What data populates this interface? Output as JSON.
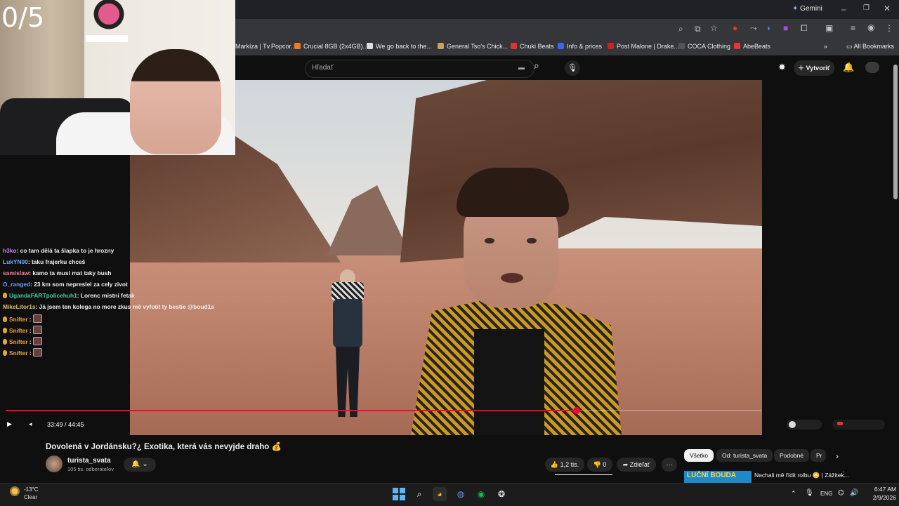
{
  "browser": {
    "gemini_label": "Gemini",
    "bookmarks": [
      {
        "label": "Markíza | Tv.Popcor...",
        "color": "#e74c3c"
      },
      {
        "label": "Crucial 8GB (2x4GB)...",
        "color": "#f07a25"
      },
      {
        "label": "We go back to the...",
        "color": "#ffffff"
      },
      {
        "label": "General Tso's Chick...",
        "color": "#c8a060"
      },
      {
        "label": "Chuki Beats",
        "color": "#d33"
      },
      {
        "label": "Info & prices",
        "color": "#3a66ff"
      },
      {
        "label": "Post Malone | Drake...",
        "color": "#c22"
      },
      {
        "label": "COCA Clothing",
        "color": "#333"
      },
      {
        "label": "AbeBeats",
        "color": "#e33"
      }
    ],
    "all_bookmarks": "All Bookmarks"
  },
  "youtube": {
    "search_placeholder": "Hľadať",
    "create_label": "Vytvoriť",
    "player": {
      "time": "33:49 / 44:45",
      "progress": 0.7557
    },
    "video_title": "Dovolená v Jordánsku?¿ Exotika, která vás nevyjde draho 💰",
    "channel": "turista_svata",
    "subscribers": "105 tis. odberateľov",
    "likes": "1,2 tis.",
    "dislikes": "0",
    "share": "Zdieľať",
    "chips": [
      "Všetko",
      "Od: turista_svata",
      "Podobné",
      "Pr"
    ],
    "rec_title": "Nechali mě řídit rolbu 😳 | Zážitek..."
  },
  "stream": {
    "counter": "0/5",
    "chat": [
      {
        "user": "h3ko",
        "color": "#c587ff",
        "text": ": co tam dělá ta šlapka to je hrozny",
        "badge": false,
        "emote": false
      },
      {
        "user": "LukYN00",
        "color": "#7aa6ff",
        "text": ": taku frajerku chceš",
        "badge": false,
        "emote": false
      },
      {
        "user": "samislaw",
        "color": "#ff7aa2",
        "text": ": kamo ta musi mat taky bush",
        "badge": false,
        "emote": false
      },
      {
        "user": "O_ranged",
        "color": "#6aa0ff",
        "text": ": 23 km som nepreslel za cely zivot",
        "badge": false,
        "emote": false
      },
      {
        "user": "UgandaFARTpolicehuh1",
        "color": "#3ccf9a",
        "text": ": Lorenc mistni fetak",
        "badge": true,
        "emote": false
      },
      {
        "user": "MikeLitor1s",
        "color": "#d6c06e",
        "text": ": Já jsem ten kolega no more zkus mě vyfotit ty bestie @boud1s",
        "badge": false,
        "emote": false
      },
      {
        "user": "Snifter",
        "color": "#f0a030",
        "text": " :",
        "badge": true,
        "emote": true
      },
      {
        "user": "Snifter",
        "color": "#f0a030",
        "text": " :",
        "badge": true,
        "emote": true
      },
      {
        "user": "Snifter",
        "color": "#f0a030",
        "text": " :",
        "badge": true,
        "emote": true
      },
      {
        "user": "Snifter",
        "color": "#f0a030",
        "text": " :",
        "badge": true,
        "emote": true
      }
    ]
  },
  "taskbar": {
    "temp": "-13°C",
    "condition": "Clear",
    "lang": "ENG",
    "time": "6:47 AM",
    "date": "2/9/2026"
  }
}
